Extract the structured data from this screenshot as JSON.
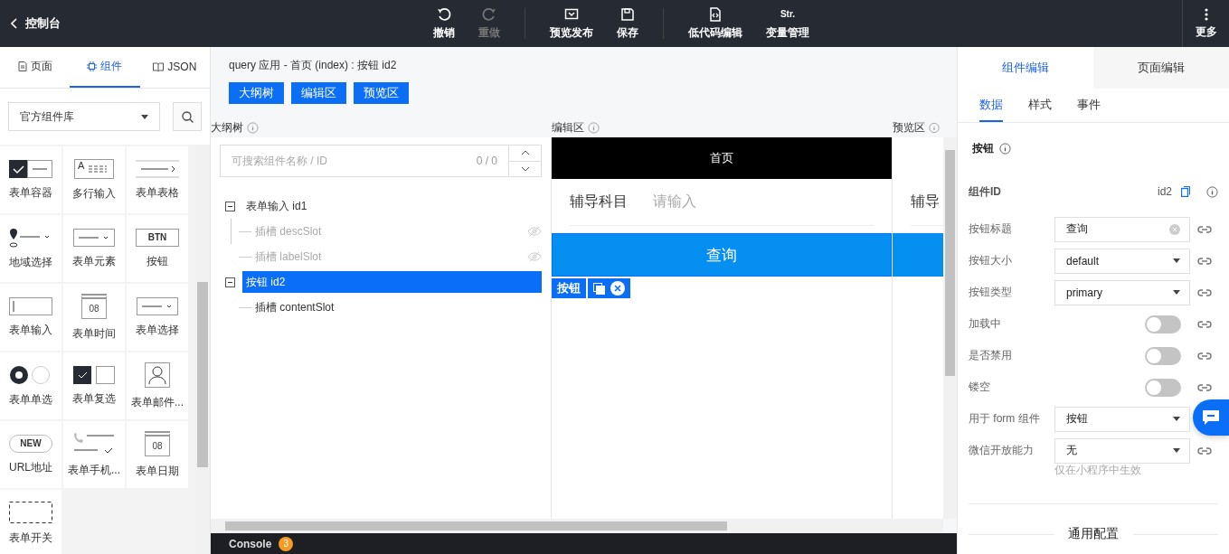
{
  "topbar": {
    "back_title": "控制台",
    "action_groups": [
      [
        {
          "label": "撤销",
          "kind": "undo",
          "disabled": false
        },
        {
          "label": "重做",
          "kind": "redo",
          "disabled": true
        }
      ],
      [
        {
          "label": "预览发布",
          "kind": "preview",
          "disabled": false
        },
        {
          "label": "保存",
          "kind": "save",
          "disabled": false
        }
      ],
      [
        {
          "label": "低代码编辑",
          "kind": "code",
          "disabled": false
        },
        {
          "label": "变量管理",
          "kind": "text",
          "icon_text": "Str.",
          "disabled": false
        }
      ]
    ],
    "more": "更多"
  },
  "left": {
    "tabs": [
      {
        "label": "页面",
        "kind": "page",
        "selected": false
      },
      {
        "label": "组件",
        "kind": "chip",
        "selected": true
      },
      {
        "label": "JSON",
        "kind": "book",
        "selected": false
      }
    ],
    "library": "官方组件库",
    "components": [
      {
        "label": "表单容器",
        "kind": "container"
      },
      {
        "label": "多行输入",
        "kind": "textarea",
        "icon_text": "A"
      },
      {
        "label": "表单表格",
        "kind": "table"
      },
      {
        "label": "地域选择",
        "kind": "region"
      },
      {
        "label": "表单元素",
        "kind": "select"
      },
      {
        "label": "按钮",
        "kind": "button",
        "icon_text": "BTN"
      },
      {
        "label": "表单输入",
        "kind": "input"
      },
      {
        "label": "表单时间",
        "kind": "calendar",
        "icon_text": "08"
      },
      {
        "label": "表单选择",
        "kind": "select"
      },
      {
        "label": "表单单选",
        "kind": "radio"
      },
      {
        "label": "表单复选",
        "kind": "checkbox"
      },
      {
        "label": "表单邮件...",
        "kind": "person"
      },
      {
        "label": "URL地址",
        "kind": "pill",
        "icon_text": "NEW"
      },
      {
        "label": "表单手机...",
        "kind": "phone"
      },
      {
        "label": "表单日期",
        "kind": "calendar",
        "icon_text": "08"
      },
      {
        "label": "表单开关",
        "kind": "dashed"
      }
    ]
  },
  "workspace": {
    "breadcrumb": "query 应用 - 首页 (index) : 按钮 id2",
    "view_buttons": [
      "大纲树",
      "编辑区",
      "预览区"
    ],
    "pane_titles": [
      "大纲树",
      "编辑区",
      "预览区"
    ],
    "tree": {
      "placeholder": "可搜索组件名称 / ID",
      "count": "0 / 0",
      "nodes": [
        {
          "label": "表单输入 id1",
          "selected": false,
          "expanded": true,
          "children": [
            {
              "label": "插槽 descSlot",
              "hidden": true
            },
            {
              "label": "插槽 labelSlot",
              "hidden": true
            }
          ]
        },
        {
          "label": "按钮 id2",
          "selected": true,
          "expanded": true,
          "children": [
            {
              "label": "插槽 contentSlot",
              "hidden": false
            }
          ]
        }
      ]
    },
    "editor": {
      "page_title": "首页",
      "field_label": "辅导科目",
      "field_placeholder": "请输入",
      "button": "查询",
      "tag": "按钮"
    },
    "preview": {
      "field_label": "辅导"
    },
    "console": {
      "label": "Console",
      "badge": "3"
    }
  },
  "right": {
    "tabs": [
      {
        "label": "组件编辑",
        "selected": true
      },
      {
        "label": "页面编辑",
        "selected": false
      }
    ],
    "subtabs": [
      {
        "label": "数据",
        "selected": true
      },
      {
        "label": "样式",
        "selected": false
      },
      {
        "label": "事件",
        "selected": false
      }
    ],
    "section_title": "按钮",
    "id_label": "组件ID",
    "id_value": "id2",
    "fields": [
      {
        "kind": "input",
        "label": "按钮标题",
        "value": "查询",
        "link": true
      },
      {
        "kind": "select",
        "label": "按钮大小",
        "value": "default",
        "link": true
      },
      {
        "kind": "select",
        "label": "按钮类型",
        "value": "primary",
        "link": true
      },
      {
        "kind": "switch",
        "label": "加载中",
        "on": false,
        "link": true
      },
      {
        "kind": "switch",
        "label": "是否禁用",
        "on": false,
        "link": true
      },
      {
        "kind": "switch",
        "label": "镂空",
        "on": false,
        "link": true
      },
      {
        "kind": "select",
        "label": "用于 form 组件",
        "value": "按钮",
        "link": false
      },
      {
        "kind": "select",
        "label": "微信开放能力",
        "value": "无",
        "link": true,
        "hint": "仅在小程序中生效"
      }
    ],
    "general_title": "通用配置"
  }
}
